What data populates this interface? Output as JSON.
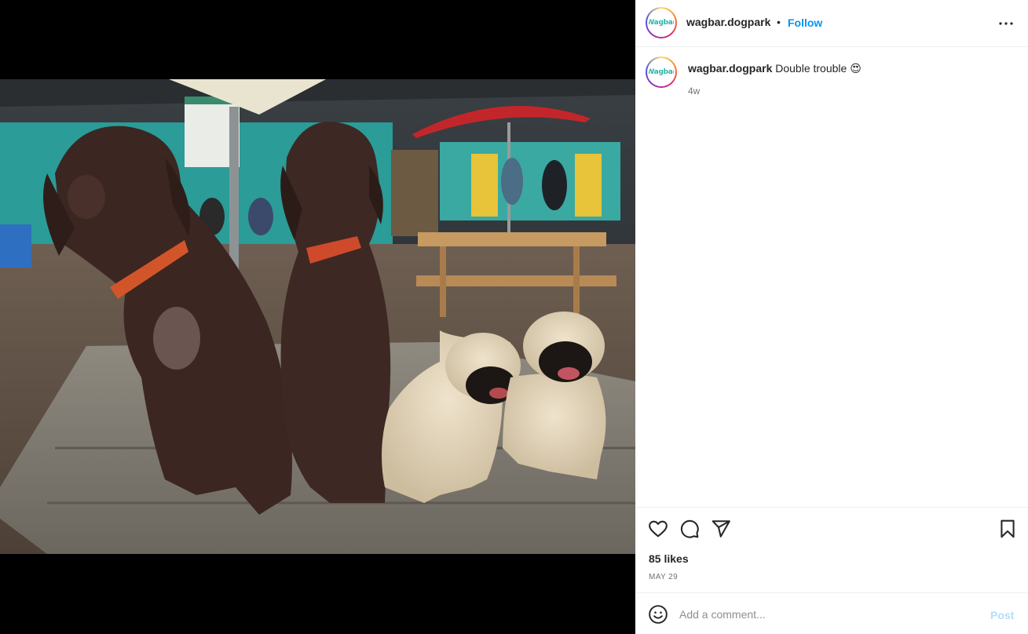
{
  "post": {
    "username": "wagbar.dogpark",
    "avatar_text": "Wagbar",
    "follow_label": "Follow",
    "separator": "•",
    "more_icon": "more-horizontal-icon"
  },
  "caption": {
    "username": "wagbar.dogpark",
    "text": "Double trouble 😍",
    "time": "4w"
  },
  "media": {
    "description_icon": "photo"
  },
  "actions": {
    "likes": "85 likes",
    "date": "MAY 29",
    "icons": [
      "heart-icon",
      "comment-icon",
      "share-icon",
      "bookmark-icon"
    ]
  },
  "comment": {
    "placeholder": "Add a comment...",
    "post_label": "Post"
  },
  "colors": {
    "accent": "#0095f6",
    "post_disabled": "#b2dffc",
    "text": "#262626",
    "muted": "#737373"
  }
}
